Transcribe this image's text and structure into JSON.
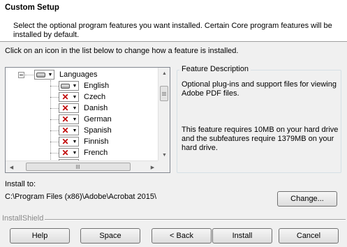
{
  "header": {
    "title": "Custom Setup",
    "description": "Select the optional program features you want installed. Certain Core program features will be installed by default."
  },
  "instruction": "Click on an icon in the list below to change how a feature is installed.",
  "tree": {
    "root": {
      "label": "Languages",
      "icon": "hard-drive-icon",
      "expanded": true
    },
    "items": [
      {
        "label": "English",
        "state": "install",
        "icon": "hard-drive-icon"
      },
      {
        "label": "Czech",
        "state": "not-available",
        "icon": "red-x-icon"
      },
      {
        "label": "Danish",
        "state": "not-available",
        "icon": "red-x-icon"
      },
      {
        "label": "German",
        "state": "not-available",
        "icon": "red-x-icon"
      },
      {
        "label": "Spanish",
        "state": "not-available",
        "icon": "red-x-icon"
      },
      {
        "label": "Finnish",
        "state": "not-available",
        "icon": "red-x-icon"
      },
      {
        "label": "French",
        "state": "not-available",
        "icon": "red-x-icon"
      }
    ]
  },
  "feature_description": {
    "legend": "Feature Description",
    "text": "Optional plug-ins and support files for viewing Adobe PDF files.",
    "size_text": "This feature requires 10MB on your hard drive and the subfeatures require 1379MB on your hard drive."
  },
  "install_to": {
    "label": "Install to:",
    "path": "C:\\Program Files (x86)\\Adobe\\Acrobat 2015\\",
    "change_button": "Change..."
  },
  "footer": {
    "brand": "InstallShield",
    "buttons": {
      "help": "Help",
      "space": "Space",
      "back": "< Back",
      "install": "Install",
      "cancel": "Cancel"
    }
  },
  "colors": {
    "accent_selected": "#0a246a",
    "x_red": "#c00000"
  }
}
